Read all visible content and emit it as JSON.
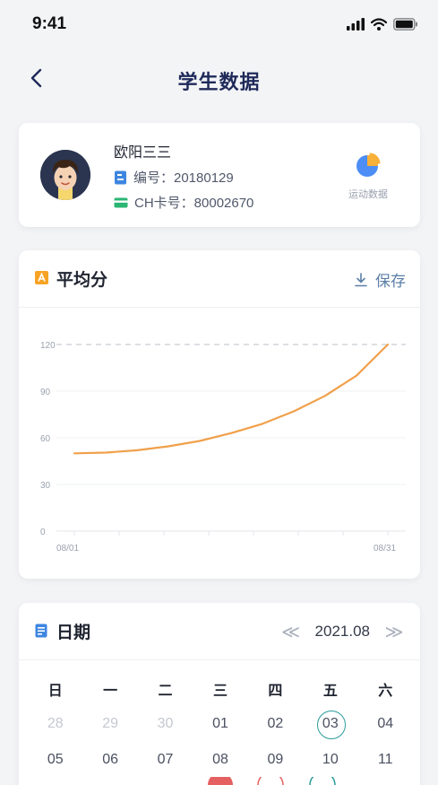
{
  "status_bar": {
    "time": "9:41"
  },
  "nav": {
    "title": "学生数据"
  },
  "profile": {
    "name": "欧阳三三",
    "id_line": "编号：20180129",
    "card_line": "CH卡号：80002670",
    "sport_label": "运动数据"
  },
  "chart_card": {
    "title": "平均分",
    "save_label": "保存"
  },
  "chart_data": {
    "type": "line",
    "x_labels": [
      "08/01",
      "08/31"
    ],
    "x": [
      "08/01",
      "08/04",
      "08/07",
      "08/10",
      "08/13",
      "08/16",
      "08/19",
      "08/22",
      "08/25",
      "08/28",
      "08/31"
    ],
    "values": [
      50,
      50.5,
      52,
      54.5,
      58,
      63,
      69,
      77,
      87,
      100,
      120
    ],
    "yticks": [
      0,
      30,
      60,
      90,
      120
    ],
    "ylim": [
      0,
      120
    ],
    "reference_line": 120,
    "line_color": "#f0a04b",
    "grid": true
  },
  "date_card": {
    "title": "日期",
    "month": "2021.08",
    "prev_label": "≪",
    "next_label": "≫",
    "weekdays": [
      "日",
      "一",
      "二",
      "三",
      "四",
      "五",
      "六"
    ],
    "weeks": [
      [
        "28",
        "29",
        "30",
        "01",
        "02",
        "03",
        "04"
      ],
      [
        "05",
        "06",
        "07",
        "08",
        "09",
        "10",
        "11"
      ]
    ],
    "selected_day": "03"
  },
  "colors": {
    "accent": "#2a9b9b",
    "line": "#f0a04b",
    "title": "#1f2a5a"
  }
}
